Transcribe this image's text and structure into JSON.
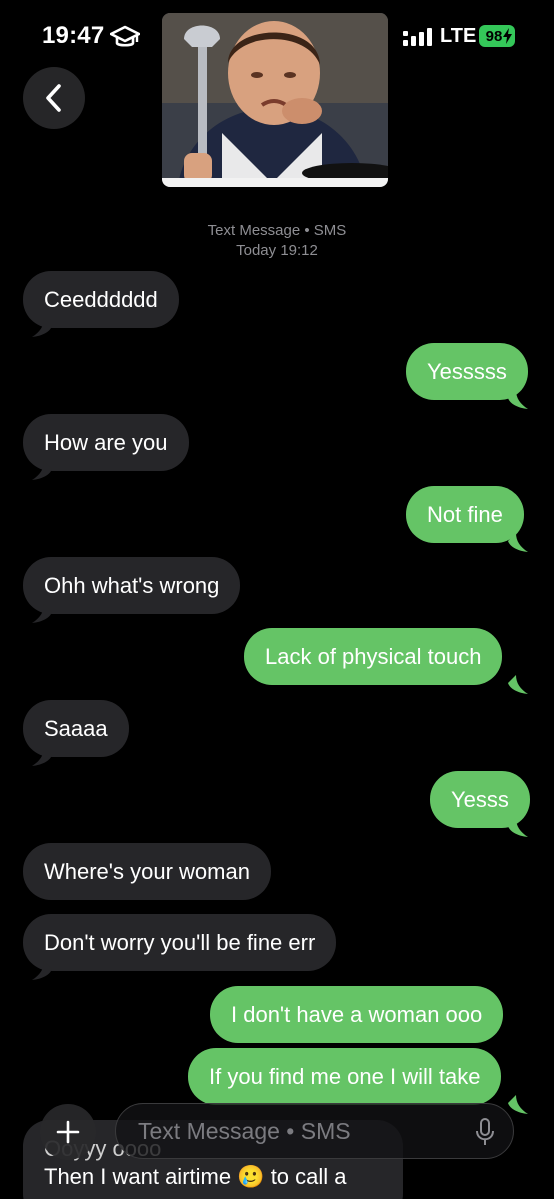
{
  "status_bar": {
    "time": "19:47",
    "network": "LTE",
    "battery": "98"
  },
  "header": {
    "avatar_icon": "contact-photo",
    "service": "Text Message • SMS",
    "date": "Today 19:12"
  },
  "messages": [
    {
      "direction": "in",
      "text": "Ceedddddd"
    },
    {
      "direction": "out",
      "text": "Yesssss"
    },
    {
      "direction": "in",
      "text": "How are you"
    },
    {
      "direction": "out",
      "text": "Not fine"
    },
    {
      "direction": "in",
      "text": "Ohh what's wrong"
    },
    {
      "direction": "out",
      "text": "Lack of physical touch"
    },
    {
      "direction": "in",
      "text": "Saaaa"
    },
    {
      "direction": "out",
      "text": "Yesss"
    },
    {
      "direction": "in",
      "text": "Where's your woman"
    },
    {
      "direction": "in",
      "text": "Don't worry you'll be fine err"
    },
    {
      "direction": "out",
      "text": "I don't have a woman ooo"
    },
    {
      "direction": "out",
      "text": "If you find me one I will take"
    },
    {
      "direction": "in",
      "text_line1": "Ooyyy oooo",
      "text_line2": "Then I want airtime 🥲 to call a"
    }
  ],
  "composer": {
    "placeholder": "Text Message • SMS"
  },
  "colors": {
    "background": "#000000",
    "incoming": "#262629",
    "outgoing": "#65c466",
    "battery": "#34c759"
  }
}
